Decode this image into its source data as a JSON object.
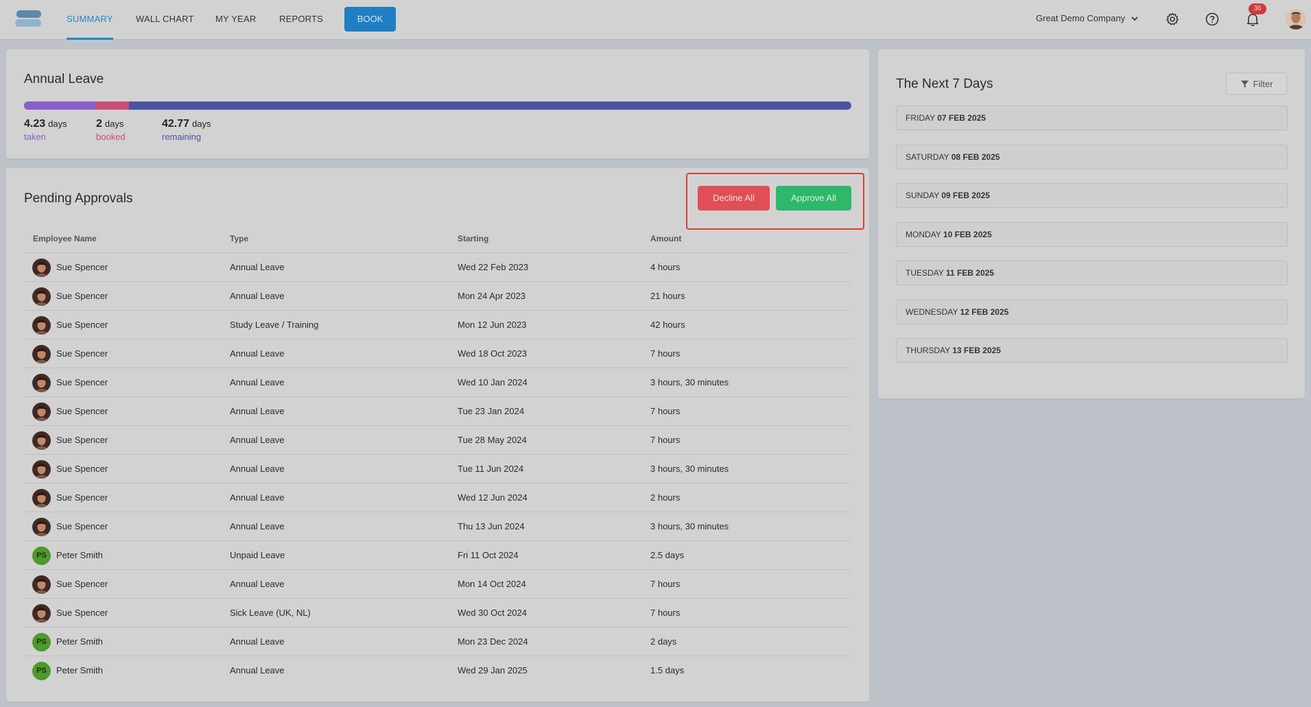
{
  "nav": {
    "tabs": [
      {
        "label": "SUMMARY"
      },
      {
        "label": "WALL CHART"
      },
      {
        "label": "MY YEAR"
      },
      {
        "label": "REPORTS"
      }
    ],
    "book_label": "BOOK",
    "company": "Great Demo Company",
    "notification_count": "36",
    "icons": [
      "settings-gear-icon",
      "help-question-icon",
      "bell-icon",
      "chevron-down-icon"
    ]
  },
  "annual_leave": {
    "title": "Annual Leave",
    "taken": {
      "value": "4.23",
      "unit": "days",
      "label": "taken",
      "color": "#8a60c8"
    },
    "booked": {
      "value": "2",
      "unit": "days",
      "label": "booked",
      "color": "#c84f76"
    },
    "remaining": {
      "value": "42.77",
      "unit": "days",
      "label": "remaining",
      "color": "#4a54a0"
    }
  },
  "pending": {
    "title": "Pending Approvals",
    "decline_label": "Decline All",
    "approve_label": "Approve All",
    "columns": [
      "Employee Name",
      "Type",
      "Starting",
      "Amount"
    ],
    "rows": [
      {
        "name": "Sue Spencer",
        "type": "Annual Leave",
        "start": "Wed 22 Feb 2023",
        "amount": "4 hours",
        "initials": ""
      },
      {
        "name": "Sue Spencer",
        "type": "Annual Leave",
        "start": "Mon 24 Apr 2023",
        "amount": "21 hours",
        "initials": ""
      },
      {
        "name": "Sue Spencer",
        "type": "Study Leave / Training",
        "start": "Mon 12 Jun 2023",
        "amount": "42 hours",
        "initials": ""
      },
      {
        "name": "Sue Spencer",
        "type": "Annual Leave",
        "start": "Wed 18 Oct 2023",
        "amount": "7 hours",
        "initials": ""
      },
      {
        "name": "Sue Spencer",
        "type": "Annual Leave",
        "start": "Wed 10 Jan 2024",
        "amount": "3 hours, 30 minutes",
        "initials": ""
      },
      {
        "name": "Sue Spencer",
        "type": "Annual Leave",
        "start": "Tue 23 Jan 2024",
        "amount": "7 hours",
        "initials": ""
      },
      {
        "name": "Sue Spencer",
        "type": "Annual Leave",
        "start": "Tue 28 May 2024",
        "amount": "7 hours",
        "initials": ""
      },
      {
        "name": "Sue Spencer",
        "type": "Annual Leave",
        "start": "Tue 11 Jun 2024",
        "amount": "3 hours, 30 minutes",
        "initials": ""
      },
      {
        "name": "Sue Spencer",
        "type": "Annual Leave",
        "start": "Wed 12 Jun 2024",
        "amount": "2 hours",
        "initials": ""
      },
      {
        "name": "Sue Spencer",
        "type": "Annual Leave",
        "start": "Thu 13 Jun 2024",
        "amount": "3 hours, 30 minutes",
        "initials": ""
      },
      {
        "name": "Peter Smith",
        "type": "Unpaid Leave",
        "start": "Fri 11 Oct 2024",
        "amount": "2.5 days",
        "initials": "PS"
      },
      {
        "name": "Sue Spencer",
        "type": "Annual Leave",
        "start": "Mon 14 Oct 2024",
        "amount": "7 hours",
        "initials": ""
      },
      {
        "name": "Sue Spencer",
        "type": "Sick Leave (UK, NL)",
        "start": "Wed 30 Oct 2024",
        "amount": "7 hours",
        "initials": ""
      },
      {
        "name": "Peter Smith",
        "type": "Annual Leave",
        "start": "Mon 23 Dec 2024",
        "amount": "2 days",
        "initials": "PS"
      },
      {
        "name": "Peter Smith",
        "type": "Annual Leave",
        "start": "Wed 29 Jan 2025",
        "amount": "1.5 days",
        "initials": "PS"
      }
    ]
  },
  "next7": {
    "title": "The Next 7 Days",
    "filter_label": "Filter",
    "days": [
      {
        "weekday": "FRIDAY",
        "date": "07 FEB 2025"
      },
      {
        "weekday": "SATURDAY",
        "date": "08 FEB 2025"
      },
      {
        "weekday": "SUNDAY",
        "date": "09 FEB 2025"
      },
      {
        "weekday": "MONDAY",
        "date": "10 FEB 2025"
      },
      {
        "weekday": "TUESDAY",
        "date": "11 FEB 2025"
      },
      {
        "weekday": "WEDNESDAY",
        "date": "12 FEB 2025"
      },
      {
        "weekday": "THURSDAY",
        "date": "13 FEB 2025"
      }
    ]
  }
}
